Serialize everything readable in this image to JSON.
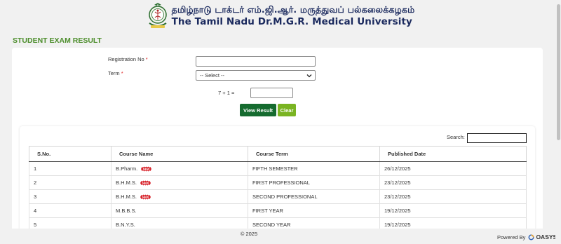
{
  "header": {
    "tamil_name": "தமிழ்நாடு டாக்டர் எம்.ஜி.ஆர். மருத்துவப் பல்கலைக்கழகம்",
    "english_name": "The Tamil Nadu Dr.M.G.R. Medical University"
  },
  "page": {
    "title": "STUDENT EXAM RESULT"
  },
  "form": {
    "registration_label": "Registration No",
    "registration_value": "",
    "term_label": "Term",
    "required_mark": "*",
    "term_selected": "-- Select --",
    "captcha_question": "7 + 1 =",
    "captcha_value": "",
    "view_button": "View Result",
    "clear_button": "Clear"
  },
  "table": {
    "search_label": "Search:",
    "search_value": "",
    "headers": [
      "S.No.",
      "Course Name",
      "Course Term",
      "Published Date"
    ],
    "new_badge_text": "NEW",
    "rows": [
      {
        "sno": "1",
        "course": "B.Pharm.",
        "term": "FIFTH SEMESTER",
        "date": "26/12/2025",
        "is_new": true
      },
      {
        "sno": "2",
        "course": "B.H.M.S.",
        "term": "FIRST PROFESSIONAL",
        "date": "23/12/2025",
        "is_new": true
      },
      {
        "sno": "3",
        "course": "B.H.M.S.",
        "term": "SECOND PROFESSIONAL",
        "date": "23/12/2025",
        "is_new": true
      },
      {
        "sno": "4",
        "course": "M.B.B.S.",
        "term": "FIRST YEAR",
        "date": "19/12/2025",
        "is_new": false
      },
      {
        "sno": "5",
        "course": "B.N.Y.S.",
        "term": "SECOND YEAR",
        "date": "19/12/2025",
        "is_new": false
      }
    ]
  },
  "footer": {
    "copyright": "© 2025",
    "powered_by": "Powered By",
    "vendor": "OASYS"
  },
  "colors": {
    "title_green": "#4c8d2b",
    "view_button": "#156b2f",
    "clear_button": "#7ab422",
    "university_blue": "#1b2a5e",
    "badge_red": "#d8262e"
  }
}
